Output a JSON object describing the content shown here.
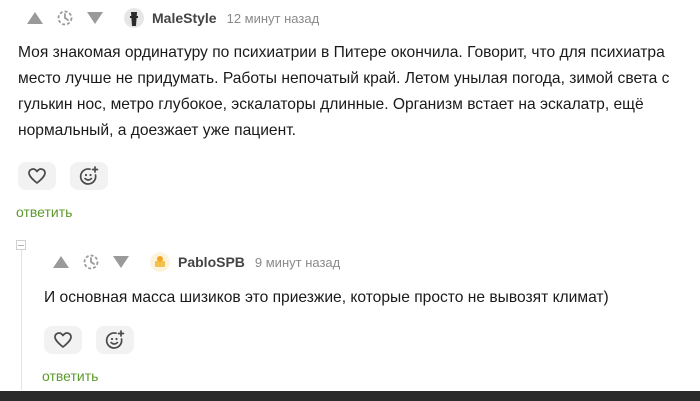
{
  "comment1": {
    "author": "MaleStyle",
    "time": "12 минут назад",
    "text": "Моя знакомая ординатуру по психиатрии в Питере окончила. Говорит, что для психиатра место лучше не придумать. Работы непочатый край. Летом унылая погода, зимой света с гулькин нос, метро глубокое, эскалаторы длинные. Организм встает на эскалатр, ещё нормальный, а доезжает уже пациент.",
    "reply_label": "ответить"
  },
  "comment2": {
    "author": "PabloSPB",
    "time": "9 минут назад",
    "text": "И основная масса шизиков это приезжие, которые просто не вывозят климат)",
    "reply_label": "ответить"
  },
  "icons": {
    "upvote": "triangle-up-icon",
    "rating": "clock-icon",
    "downvote": "triangle-down-icon",
    "like": "heart-icon",
    "reaction": "smiley-plus-icon"
  },
  "colors": {
    "reply_link": "#5c9a2c",
    "vote_icon": "#9a9a9a",
    "action_bg": "#f2f2f2"
  }
}
